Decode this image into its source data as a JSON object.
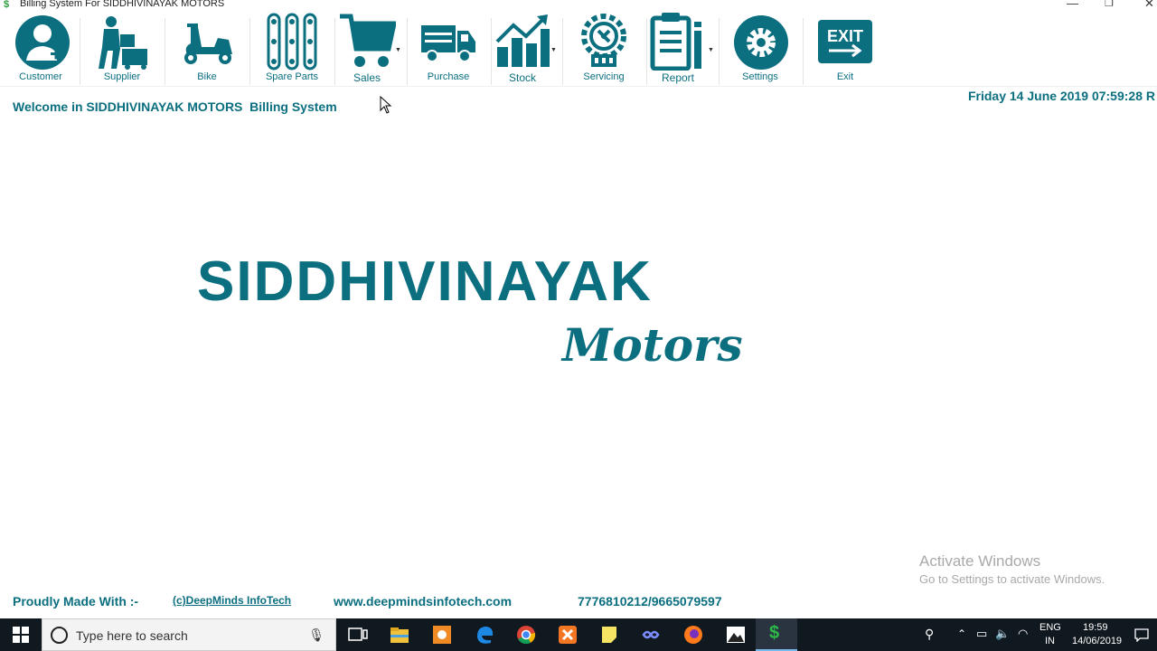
{
  "window": {
    "title": "Billing System For SIDDHIVINAYAK MOTORS",
    "controls": [
      "—",
      "❐",
      "✕"
    ]
  },
  "toolbar": {
    "customer": "Customer",
    "supplier": "Supplier",
    "bike": "Bike",
    "spare_parts": "Spare Parts",
    "sales": "Sales",
    "purchase": "Purchase",
    "stock": "Stock",
    "servicing": "Servicing",
    "report": "Report",
    "settings": "Settings",
    "exit": "Exit",
    "exit_icon_text": "EXIT"
  },
  "main": {
    "welcome": "Welcome in SIDDHIVINAYAK MOTORS  Billing System",
    "datetime": "Friday 14 June 2019 07:59:28 R",
    "brand_name": "SIDDHIVINAYAK",
    "brand_sub": "Motors"
  },
  "footer": {
    "made_with": "Proudly Made With :-",
    "company": "(c)DeepMinds InfoTech",
    "website": "www.deepmindsinfotech.com",
    "phone": "7776810212/9665079597"
  },
  "watermark": {
    "line1": "Activate Windows",
    "line2": "Go to Settings to activate Windows."
  },
  "taskbar": {
    "search_placeholder": "Type here to search",
    "lang_top": "ENG",
    "lang_bottom": "IN",
    "time": "19:59",
    "date": "14/06/2019"
  },
  "colors": {
    "accent": "#0b6f80",
    "taskbar": "#101820"
  }
}
